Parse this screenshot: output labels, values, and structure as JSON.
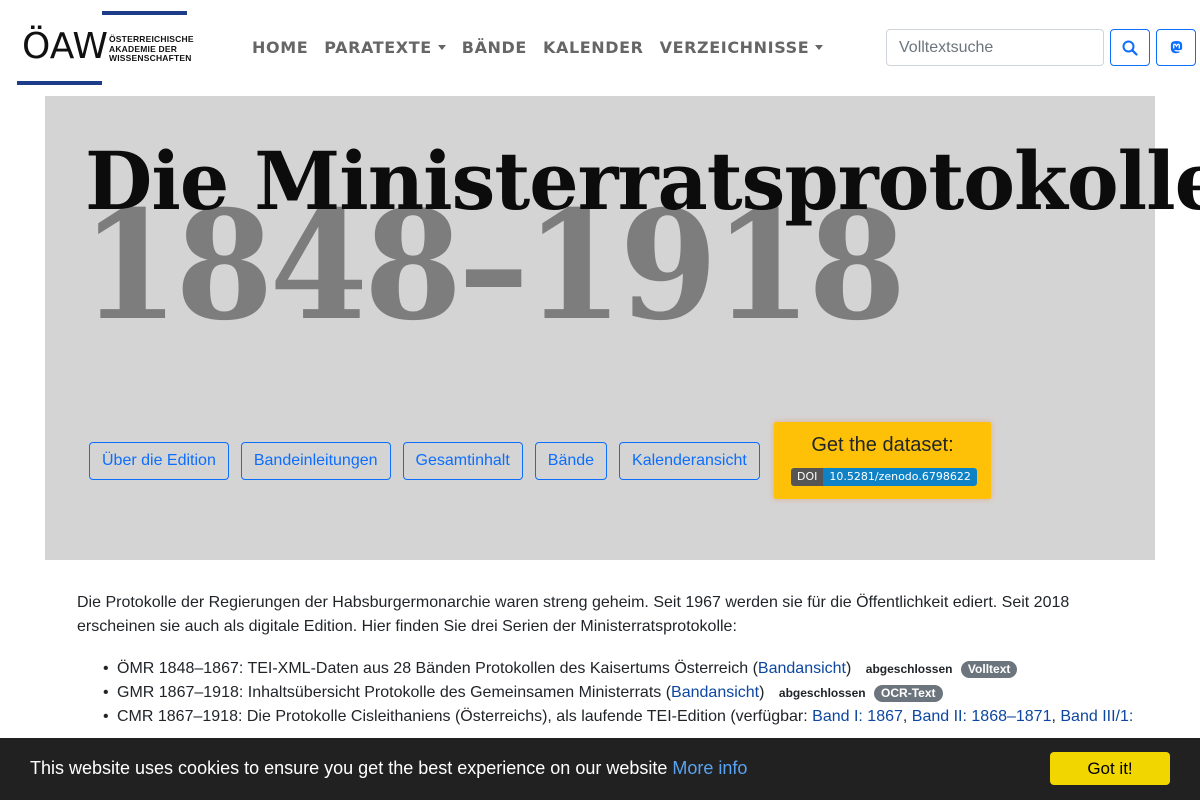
{
  "logo": {
    "main": "ÖAW",
    "line1": "ÖSTERREICHISCHE",
    "line2": "AKADEMIE DER",
    "line3": "WISSENSCHAFTEN",
    "brand_color": "#1d3c8a"
  },
  "nav": {
    "items": [
      {
        "label": "HOME",
        "dropdown": false
      },
      {
        "label": "PARATEXTE",
        "dropdown": true
      },
      {
        "label": "BÄNDE",
        "dropdown": false
      },
      {
        "label": "KALENDER",
        "dropdown": false
      },
      {
        "label": "VERZEICHNISSE",
        "dropdown": true
      }
    ],
    "search_placeholder": "Volltextsuche",
    "search_icon": "search-icon",
    "social_icon": "mastodon-icon"
  },
  "hero": {
    "title": "Die Ministerratsprotokolle",
    "years": "1848–1918",
    "buttons": [
      "Über die Edition",
      "Bandeinleitungen",
      "Gesamtinhalt",
      "Bände",
      "Kalenderansicht"
    ],
    "dataset_label": "Get the dataset:",
    "doi_key": "DOI",
    "doi_value": "10.5281/zenodo.6798622",
    "bg_color": "#d4d4d4",
    "accent_color": "#ffc107"
  },
  "intro": "Die Protokolle der Regierungen der Habsburgermonarchie waren streng geheim. Seit 1967 werden sie für die Öffentlichkeit ediert. Seit 2018 erscheinen sie auch als digitale Edition. Hier finden Sie drei Serien der Ministerratsprotokolle:",
  "series": [
    {
      "text": "ÖMR 1848–1867: TEI-XML-Daten aus 28 Bänden Protokollen des Kaisertums Österreich (",
      "link": "Bandansicht",
      "after": ")",
      "status": "abgeschlossen",
      "type": "Volltext"
    },
    {
      "text": "GMR 1867–1918: Inhaltsübersicht Protokolle des Gemeinsamen Ministerrats (",
      "link": "Bandansicht",
      "after": ")",
      "status": "abgeschlossen",
      "type": "OCR-Text"
    },
    {
      "text": "CMR 1867–1918: Die Protokolle Cisleithaniens (Österreichs), als laufende TEI-Edition (verfügbar: ",
      "links": [
        "Band I: 1867",
        "Band II: 1868–1871",
        "Band III/1:"
      ]
    }
  ],
  "cookie": {
    "message": "This website uses cookies to ensure you get the best experience on our website",
    "more": "More info",
    "accept": "Got it!"
  }
}
